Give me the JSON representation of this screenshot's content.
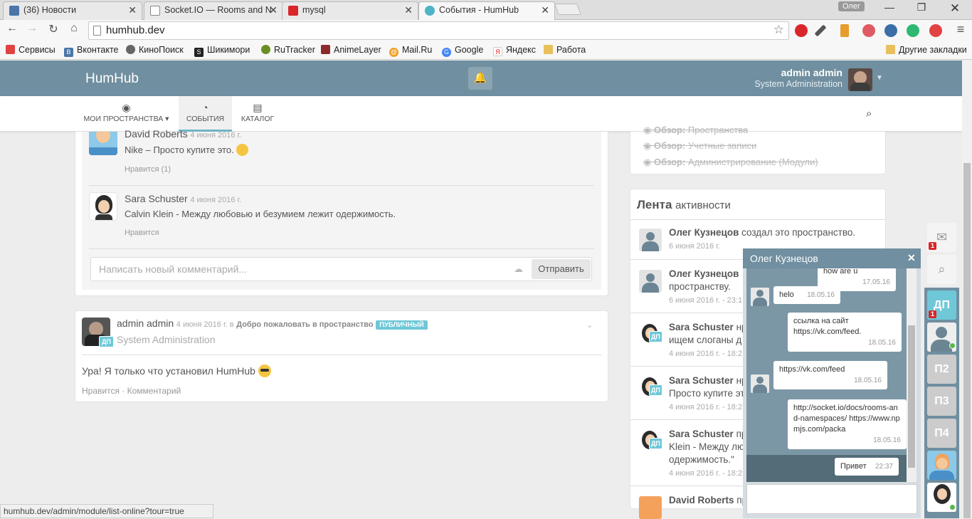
{
  "browser": {
    "tabs": [
      {
        "title": "(36) Новости"
      },
      {
        "title": "Socket.IO — Rooms and N"
      },
      {
        "title": "mysql"
      },
      {
        "title": "События - HumHub"
      }
    ],
    "profile": "Олег",
    "url": "humhub.dev",
    "status_url": "humhub.dev/admin/module/list-online?tour=true"
  },
  "bookmarks": [
    "Сервисы",
    "Вконтакте",
    "КиноПоиск",
    "Шикимори",
    "RuTracker",
    "AnimeLayer",
    "Mail.Ru",
    "Google",
    "Яндекс",
    "Работа"
  ],
  "other_bookmarks": "Другие закладки",
  "app": {
    "brand": "HumHub",
    "user_name": "admin admin",
    "user_role": "System Administration",
    "nav": {
      "spaces": "МОИ ПРОСТРАНСТВА",
      "events": "СОБЫТИЯ",
      "catalog": "КАТАЛОГ"
    }
  },
  "comments": [
    {
      "author": "David Roberts",
      "date": "4 июня 2016 г.",
      "text": "Nike – Просто купите это.",
      "like": "Нравится (1)"
    },
    {
      "author": "Sara Schuster",
      "date": "4 июня 2016 г.",
      "text": "Calvin Klein - Между любовью и безумием лежит одержимость.",
      "like": "Нравится"
    }
  ],
  "comment_input_placeholder": "Написать новый комментарий...",
  "send_label": "Отправить",
  "post": {
    "author": "admin admin",
    "meta": "4 июня 2016 г. в",
    "space": "Добро пожаловать в пространство",
    "badge": "ПУБЛИЧНЫЙ",
    "role": "System Administration",
    "space_tag": "ДП",
    "text": "Ура! Я только что установил HumHub",
    "like": "Нравится",
    "sep": "·",
    "comment": "Комментарий"
  },
  "tour": [
    {
      "b": "Обзор:",
      "t": "Пространства"
    },
    {
      "b": "Обзор:",
      "t": "Учетные записи"
    },
    {
      "b": "Обзор:",
      "t": "Администрирование (Модули)"
    }
  ],
  "activity": {
    "title_bold": "Лента",
    "title_rest": "активности",
    "items": [
      {
        "name": "Олег Кузнецов",
        "text": "создал это пространство.",
        "date": "6 июня 2016 г.",
        "tag": ""
      },
      {
        "name": "Олег Кузнецов",
        "text": "пространству.",
        "date": "6 июня 2016 г. - 23:1",
        "tag": ""
      },
      {
        "name": "Sara Schuster",
        "text": "нр ищем слоганы д",
        "date": "4 июня 2016 г. - 18:2",
        "tag": "ДП"
      },
      {
        "name": "Sara Schuster",
        "text": "нр Просто купите эт",
        "date": "4 июня 2016 г. - 18:2",
        "tag": "ДП"
      },
      {
        "name": "Sara Schuster",
        "text": "пр Klein - Между лю одержимость.\"",
        "date": "4 июня 2016 г. - 18:2",
        "tag": "ДП"
      },
      {
        "name": "David Roberts",
        "text": "пр",
        "date": "",
        "tag": ""
      }
    ]
  },
  "chat": {
    "title": "Олег Кузнецов",
    "messages": [
      {
        "text": "how are u",
        "date": "17.05.16",
        "side": "right"
      },
      {
        "text": "helo",
        "date": "18.05.16",
        "side": "left"
      },
      {
        "text": "ссылка на сайт https://vk.com/feed.",
        "date": "18.05.16",
        "side": "right"
      },
      {
        "text": "https://vk.com/feed",
        "date": "18.05.16",
        "side": "left"
      },
      {
        "text": "http://socket.io/docs/rooms-and-namespaces/ https://www.npmjs.com/packa",
        "date": "18.05.16",
        "side": "right"
      },
      {
        "text": "Привет",
        "date": "22:37",
        "side": "right"
      }
    ]
  },
  "rightbar": {
    "mail_count": "1",
    "spaces": [
      "ДП",
      "П2",
      "П3",
      "П4"
    ],
    "space_count": "1"
  },
  "colors": {
    "topbar": "#708fa0",
    "accent": "#6fc8d8",
    "danger": "#d9262b",
    "online": "#56b847"
  }
}
